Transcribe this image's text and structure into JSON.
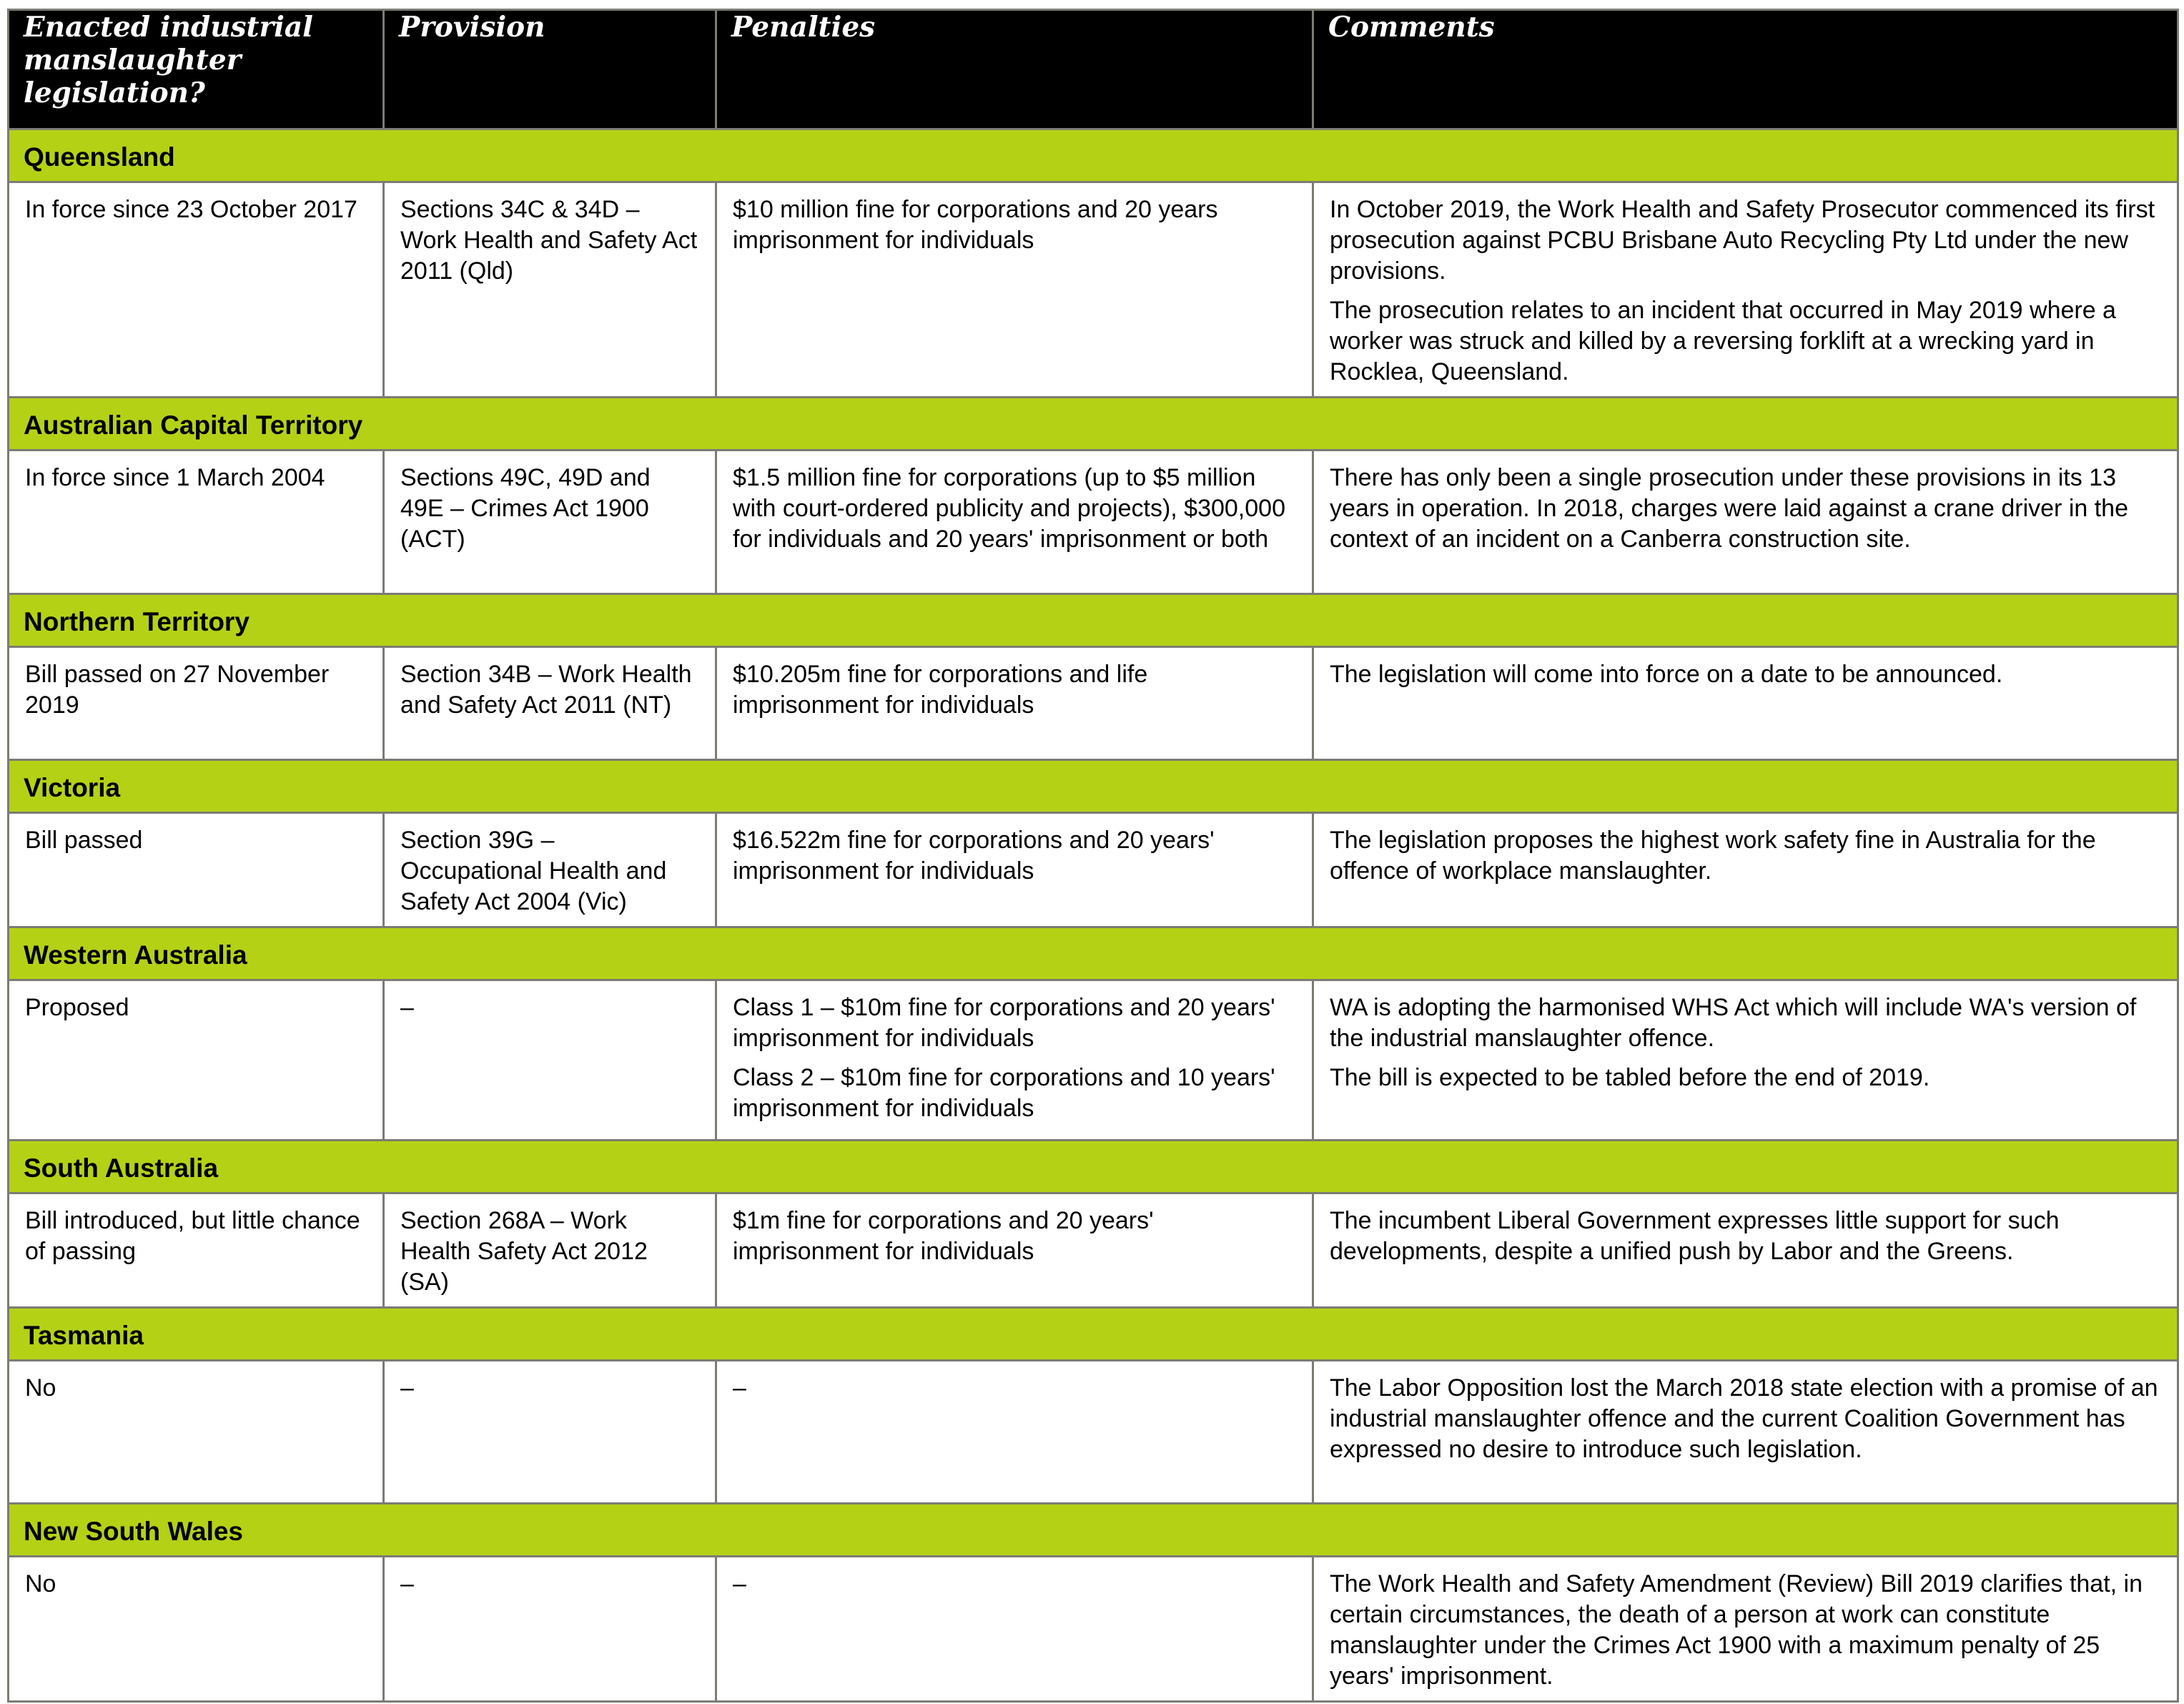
{
  "colors": {
    "header_bg": "#000000",
    "header_text": "#ffffff",
    "band_bg": "#b5d116",
    "border": "#7d7c74"
  },
  "table": {
    "headers": [
      "Enacted industrial manslaughter legislation?",
      "Provision",
      "Penalties",
      "Comments"
    ],
    "jurisdictions": [
      {
        "name": "Queensland",
        "status": "In force since 23 October 2017",
        "provision": "Sections 34C & 34D – Work Health and Safety Act 2011 (Qld)",
        "penalties": [
          "$10 million fine for corporations and 20 years imprisonment for individuals"
        ],
        "comments": [
          "In October 2019, the Work Health and Safety Prosecutor commenced its first prosecution against PCBU Brisbane Auto Recycling Pty Ltd under the new provisions.",
          "The prosecution relates to an incident that occurred in May 2019 where a worker was struck and killed by a reversing forklift at a wrecking yard in Rocklea, Queensland."
        ]
      },
      {
        "name": "Australian Capital Territory",
        "status": "In force since 1 March 2004",
        "provision": "Sections 49C, 49D and 49E – Crimes Act 1900 (ACT)",
        "penalties": [
          "$1.5 million fine for corporations (up to $5 million with court-ordered publicity and projects), $300,000 for individuals and 20 years' imprisonment or both"
        ],
        "comments": [
          "There has only been a single prosecution under these provisions in its 13 years in operation. In 2018, charges were laid against a crane driver in the context of an incident on a Canberra construction site."
        ]
      },
      {
        "name": "Northern Territory",
        "status": "Bill passed on 27 November 2019",
        "provision": "Section 34B – Work Health and Safety Act 2011 (NT)",
        "penalties": [
          "$10.205m fine for corporations and life imprisonment for individuals"
        ],
        "comments": [
          "The legislation will come into force on a date to be announced."
        ]
      },
      {
        "name": "Victoria",
        "status": "Bill passed",
        "provision": "Section 39G – Occupational Health and Safety Act 2004 (Vic)",
        "penalties": [
          "$16.522m fine for corporations and 20 years' imprisonment for individuals"
        ],
        "comments": [
          "The legislation proposes the highest work safety fine in Australia for the offence of workplace manslaughter."
        ]
      },
      {
        "name": "Western Australia",
        "status": "Proposed",
        "provision": "–",
        "penalties": [
          "Class 1 – $10m fine for corporations and 20 years' imprisonment for individuals",
          "Class 2 – $10m fine for corporations and 10 years' imprisonment for individuals"
        ],
        "comments": [
          "WA is adopting the harmonised WHS Act which will include WA's version of the industrial manslaughter offence.",
          "The bill is expected to be tabled before the end of 2019."
        ]
      },
      {
        "name": "South Australia",
        "status": "Bill introduced, but little chance of passing",
        "provision": "Section 268A – Work Health Safety Act 2012 (SA)",
        "penalties": [
          "$1m fine for corporations and 20 years' imprisonment for individuals"
        ],
        "comments": [
          "The incumbent Liberal Government expresses little support for such developments, despite a unified push by Labor and the Greens."
        ]
      },
      {
        "name": "Tasmania",
        "status": "No",
        "provision": "–",
        "penalties": [
          "–"
        ],
        "comments": [
          "The Labor Opposition lost the March 2018 state election with a promise of an industrial manslaughter offence and the current Coalition Government has expressed no desire to introduce such legislation."
        ]
      },
      {
        "name": "New South Wales",
        "status": "No",
        "provision": "–",
        "penalties": [
          "–"
        ],
        "comments": [
          "The Work Health and Safety Amendment (Review) Bill 2019 clarifies that, in certain circumstances, the death of a person at work can constitute manslaughter under the Crimes Act 1900 with a maximum penalty of 25 years' imprisonment."
        ]
      }
    ]
  }
}
